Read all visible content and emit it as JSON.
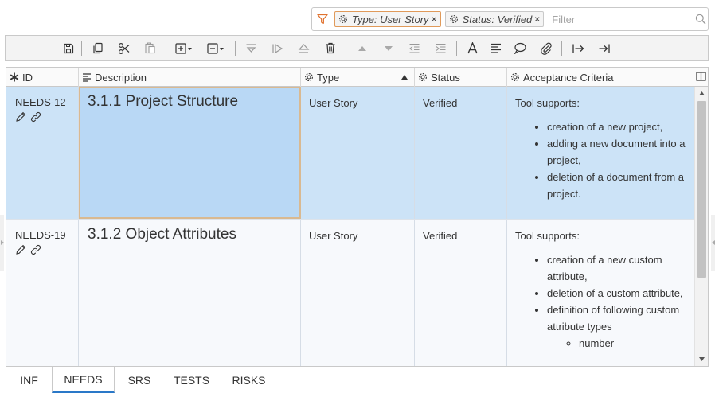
{
  "filter": {
    "chips": [
      {
        "label": "Type: User Story",
        "remove": "×"
      },
      {
        "label": "Status: Verified",
        "remove": "×"
      }
    ],
    "placeholder": "Filter"
  },
  "toolbar": {
    "icons": [
      "save-icon",
      "copy-icon",
      "cut-icon",
      "paste-icon",
      "add-row-icon",
      "remove-row-icon",
      "collapse-icon",
      "next-icon",
      "eject-icon",
      "delete-icon",
      "move-up-icon",
      "move-down-icon",
      "outdent-icon",
      "indent-icon",
      "font-icon",
      "align-icon",
      "comment-icon",
      "attach-icon",
      "go-to-icon",
      "go-end-icon"
    ]
  },
  "grid": {
    "columns": {
      "id": "ID",
      "description": "Description",
      "type": "Type",
      "status": "Status",
      "acceptance": "Acceptance Criteria"
    },
    "rows": [
      {
        "id": "NEEDS-12",
        "description": "3.1.1 Project Structure",
        "type": "User Story",
        "status": "Verified",
        "ac_intro": "Tool supports:",
        "ac_items": [
          "creation of a new project,",
          "adding a new document into a project,",
          "deletion of a document from a project."
        ]
      },
      {
        "id": "NEEDS-19",
        "description": "3.1.2 Object Attributes",
        "type": "User Story",
        "status": "Verified",
        "ac_intro": "Tool supports:",
        "ac_items": [
          "creation of a new custom attribute,",
          "deletion of a custom attribute,",
          "definition of following custom attribute types"
        ],
        "ac_subitems": [
          "number"
        ]
      }
    ]
  },
  "tabs": [
    "INF",
    "NEEDS",
    "SRS",
    "TESTS",
    "RISKS"
  ],
  "active_tab": "NEEDS",
  "colors": {
    "selected_row": "#cce3f7",
    "accent": "#2a78c8",
    "filter_icon": "#e0722e"
  }
}
